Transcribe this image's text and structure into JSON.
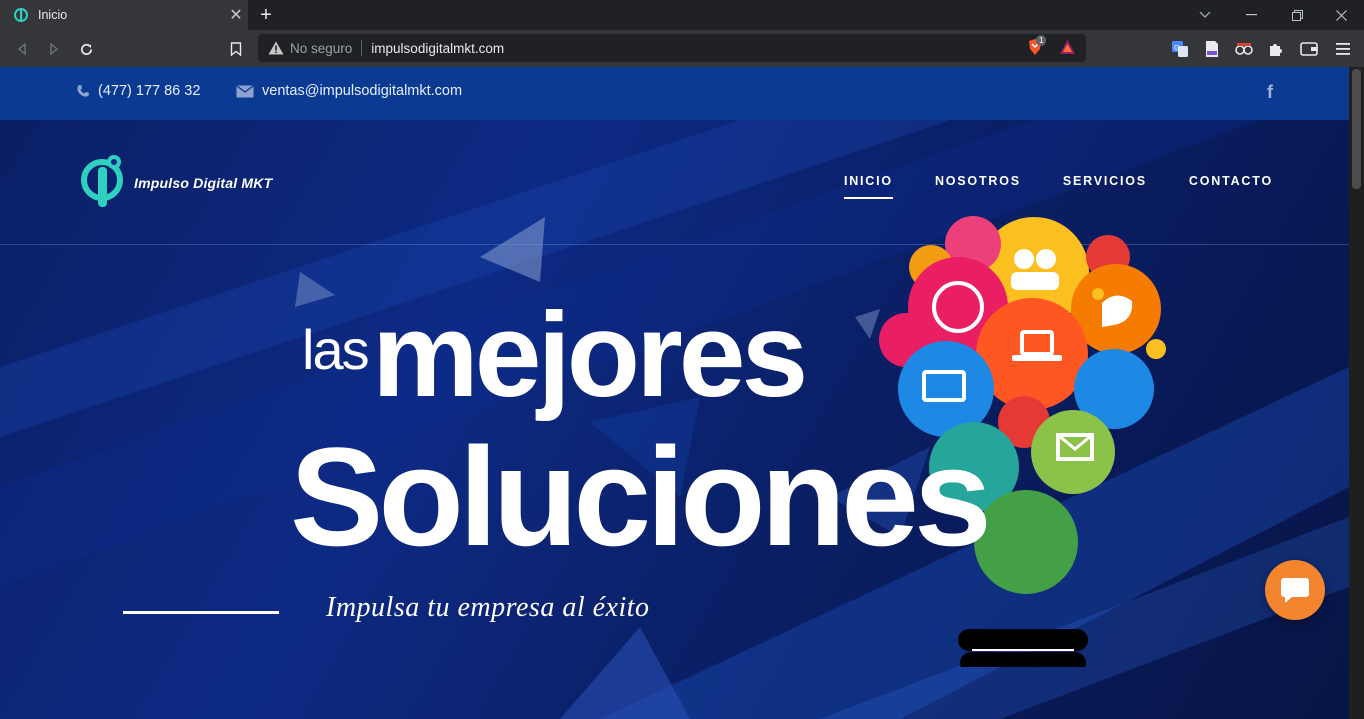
{
  "browser": {
    "tab": {
      "title": "Inicio",
      "icon": "site-favicon-icon"
    },
    "address": {
      "security_label": "No seguro",
      "url": "impulsodigitalmkt.com"
    },
    "badge_count": "1"
  },
  "site": {
    "topbar": {
      "phone": "(477) 177 86 32",
      "email": "ventas@impulsodigitalmkt.com"
    },
    "logo_text": "Impulso Digital MKT",
    "nav": [
      {
        "label": "INICIO",
        "active": true
      },
      {
        "label": "NOSOTROS",
        "active": false
      },
      {
        "label": "SERVICIOS",
        "active": false
      },
      {
        "label": "CONTACTO",
        "active": false
      }
    ],
    "hero": {
      "word_las": "las",
      "word_mejores": "mejores",
      "word_soluciones": "Soluciones",
      "tagline": "Impulsa tu empresa al éxito"
    }
  },
  "colors": {
    "accent_orange": "#f4852f",
    "topbar_blue": "#0b3a93",
    "logo_teal": "#2fd0c0"
  }
}
